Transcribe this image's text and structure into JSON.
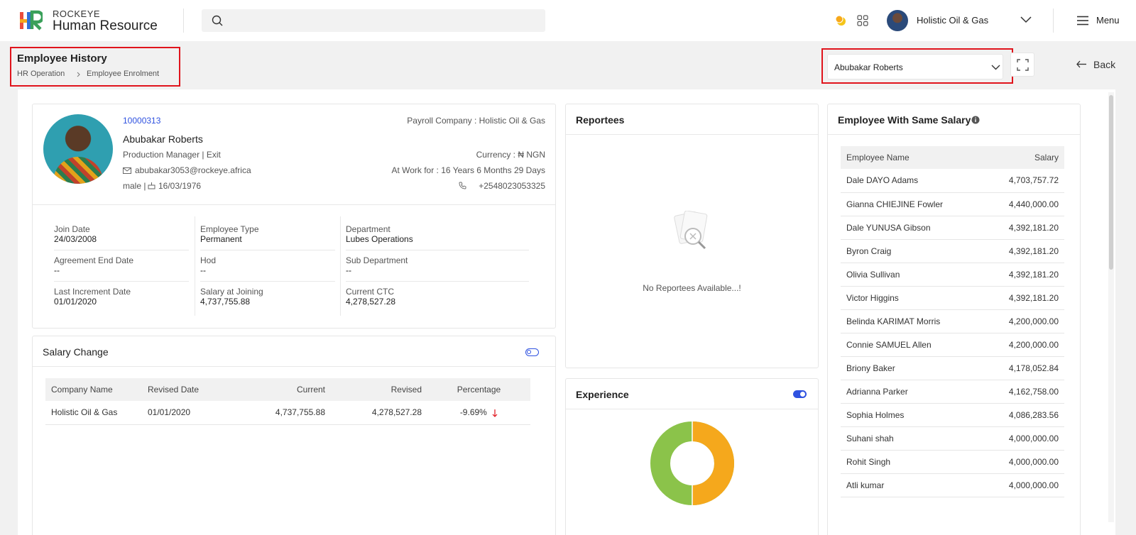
{
  "header": {
    "brand_top": "ROCKEYE",
    "brand_main": "Human Resource",
    "company": "Holistic Oil & Gas",
    "menu_label": "Menu"
  },
  "page": {
    "title": "Employee History",
    "breadcrumb": [
      "HR Operation",
      "Employee Enrolment"
    ],
    "selected_employee": "Abubakar Roberts",
    "back_label": "Back"
  },
  "profile": {
    "id": "10000313",
    "name": "Abubakar Roberts",
    "role": "Production Manager | Exit",
    "email": "abubakar3053@rockeye.africa",
    "gender": "male |",
    "dob": "16/03/1976",
    "payroll_company": "Payroll Company : Holistic Oil & Gas",
    "currency": "Currency : ₦ NGN",
    "at_work_for": "At Work for : 16 Years 6 Months 29 Days",
    "phone": "+2548023053325",
    "details": [
      {
        "label": "Join Date",
        "value": "24/03/2008"
      },
      {
        "label": "Employee Type",
        "value": "Permanent"
      },
      {
        "label": "Department",
        "value": "Lubes Operations"
      },
      {
        "label": "Agreement End Date",
        "value": "--"
      },
      {
        "label": "Hod",
        "value": "--"
      },
      {
        "label": "Sub Department",
        "value": "--"
      },
      {
        "label": "Last Increment Date",
        "value": "01/01/2020"
      },
      {
        "label": "Salary at Joining",
        "value": "4,737,755.88"
      },
      {
        "label": "Current CTC",
        "value": "4,278,527.28"
      }
    ]
  },
  "salary_change": {
    "title": "Salary Change",
    "columns": [
      "Company Name",
      "Revised Date",
      "Current",
      "Revised",
      "Percentage"
    ],
    "rows": [
      {
        "company": "Holistic Oil & Gas",
        "date": "01/01/2020",
        "current": "4,737,755.88",
        "revised": "4,278,527.28",
        "percentage": "-9.69%"
      }
    ]
  },
  "reportees": {
    "title": "Reportees",
    "empty_text": "No Reportees Available...!"
  },
  "experience": {
    "title": "Experience"
  },
  "same_salary": {
    "title": "Employee With Same Salary",
    "columns": [
      "Employee Name",
      "Salary"
    ],
    "rows": [
      {
        "name": "Dale DAYO Adams",
        "salary": "4,703,757.72"
      },
      {
        "name": "Gianna CHIEJINE Fowler",
        "salary": "4,440,000.00"
      },
      {
        "name": "Dale YUNUSA Gibson",
        "salary": "4,392,181.20"
      },
      {
        "name": "Byron Craig",
        "salary": "4,392,181.20"
      },
      {
        "name": "Olivia Sullivan",
        "salary": "4,392,181.20"
      },
      {
        "name": "Victor Higgins",
        "salary": "4,392,181.20"
      },
      {
        "name": "Belinda KARIMAT Morris",
        "salary": "4,200,000.00"
      },
      {
        "name": "Connie SAMUEL Allen",
        "salary": "4,200,000.00"
      },
      {
        "name": "Briony Baker",
        "salary": "4,178,052.84"
      },
      {
        "name": "Adrianna Parker",
        "salary": "4,162,758.00"
      },
      {
        "name": "Sophia Holmes",
        "salary": "4,086,283.56"
      },
      {
        "name": "Suhani shah",
        "salary": "4,000,000.00"
      },
      {
        "name": "Rohit Singh",
        "salary": "4,000,000.00"
      },
      {
        "name": "Atli kumar",
        "salary": "4,000,000.00"
      }
    ]
  },
  "colors": {
    "accent_blue": "#2f52e0",
    "highlight_red": "#e0141c",
    "donut_green": "#8bc34a",
    "donut_orange": "#f5a81c"
  }
}
